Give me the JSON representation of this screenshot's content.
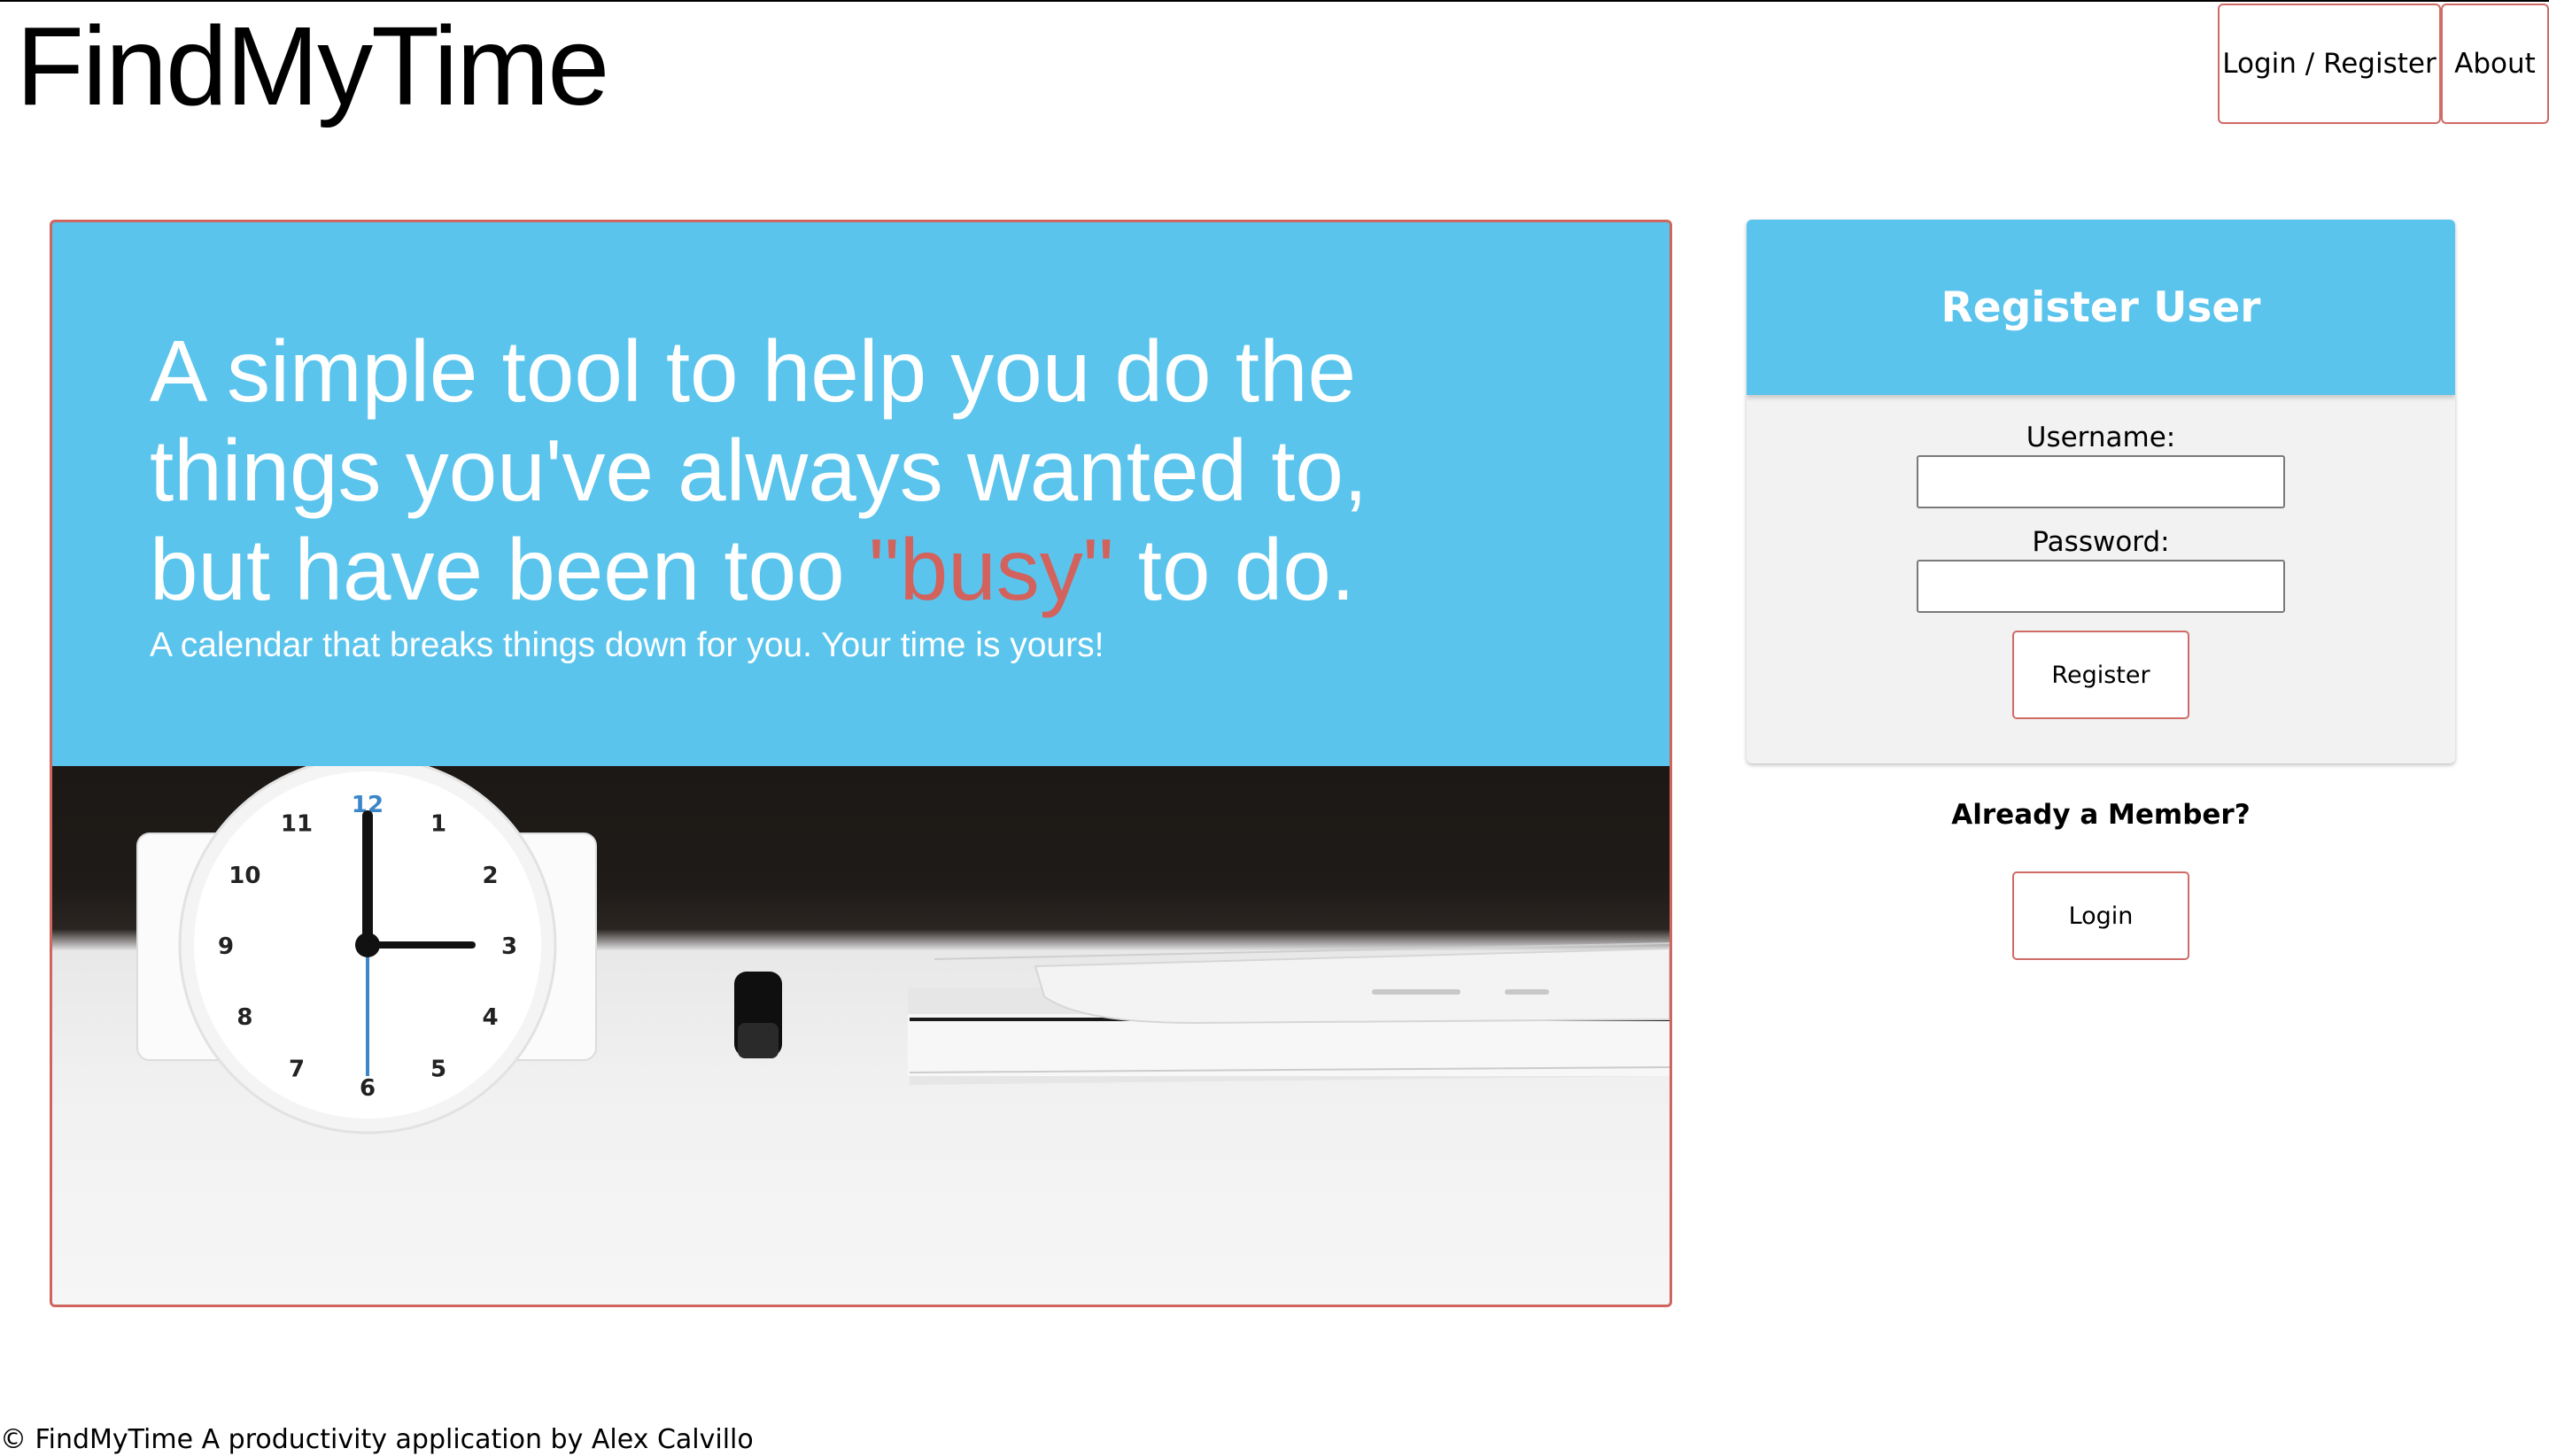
{
  "brand": {
    "name": "FindMyTime"
  },
  "nav": {
    "login_register": "Login / Register",
    "about": "About"
  },
  "hero": {
    "headline_line1": "A simple tool to help you do the",
    "headline_line2": "things you've always wanted to,",
    "headline_line3_start": "but have been too ",
    "headline_highlight": "\"busy\"",
    "headline_line3_end": " to do.",
    "subtitle": "A calendar that breaks things down for you. Your time is yours!",
    "photo": {
      "clock_numbers": [
        "12",
        "1",
        "2",
        "3",
        "4",
        "5",
        "6",
        "7",
        "8",
        "9",
        "10",
        "11"
      ]
    }
  },
  "register_form": {
    "title": "Register User",
    "username_label": "Username:",
    "username_value": "",
    "password_label": "Password:",
    "password_value": "",
    "submit_label": "Register"
  },
  "member": {
    "prompt": "Already a Member?",
    "login_label": "Login"
  },
  "footer": {
    "text": "© FindMyTime A productivity application by Alex Calvillo"
  },
  "colors": {
    "accent_blue": "#5ac4ed",
    "accent_red": "#d06b66",
    "highlight_red": "#d3625d",
    "card_bg": "#f2f2f2"
  }
}
